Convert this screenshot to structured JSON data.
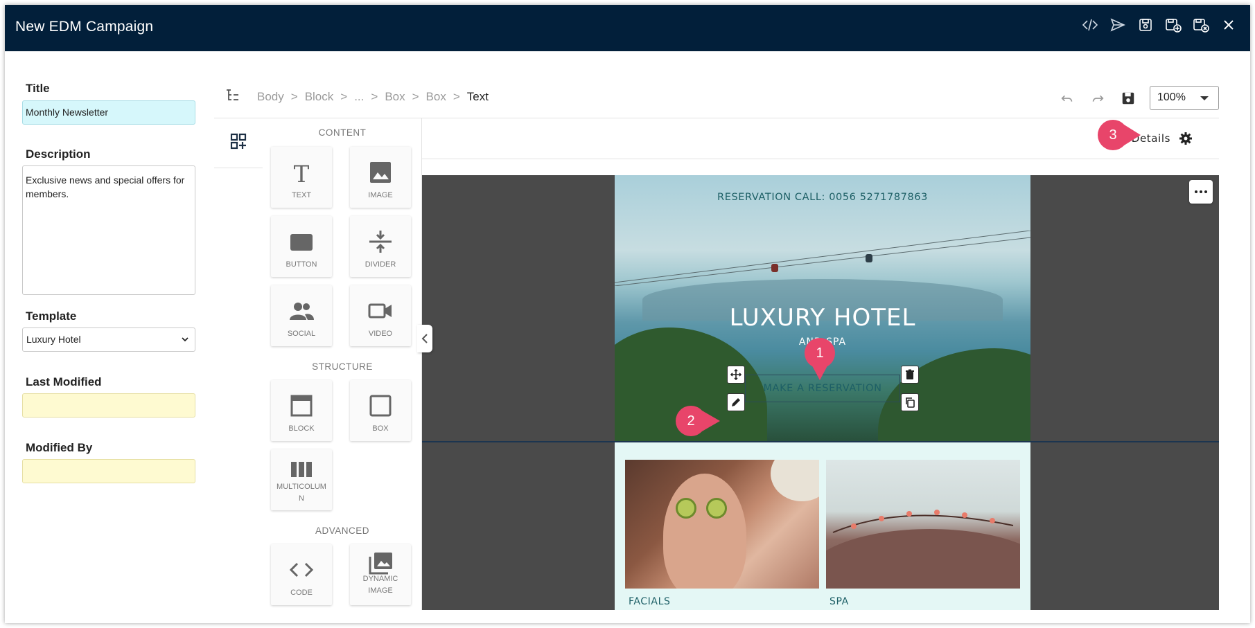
{
  "window": {
    "title": "New EDM Campaign",
    "actions": [
      "code-icon",
      "send-icon",
      "save-icon",
      "save-as-icon",
      "save-close-icon",
      "close-icon"
    ]
  },
  "form": {
    "title_label": "Title",
    "title_value": "Monthly Newsletter",
    "description_label": "Description",
    "description_value": "Exclusive news and special offers for members.",
    "template_label": "Template",
    "template_value": "Luxury Hotel",
    "last_modified_label": "Last Modified",
    "last_modified_value": "",
    "modified_by_label": "Modified By",
    "modified_by_value": ""
  },
  "breadcrumb": {
    "items": [
      "Body",
      "Block",
      "...",
      "Box",
      "Box"
    ],
    "current": "Text",
    "separator": ">"
  },
  "toolbar": {
    "zoom": "100%"
  },
  "blocks": {
    "content_title": "CONTENT",
    "structure_title": "STRUCTURE",
    "advanced_title": "ADVANCED",
    "content": [
      {
        "label": "TEXT",
        "icon": "text-icon"
      },
      {
        "label": "IMAGE",
        "icon": "image-icon"
      },
      {
        "label": "BUTTON",
        "icon": "button-icon"
      },
      {
        "label": "DIVIDER",
        "icon": "divider-icon"
      },
      {
        "label": "SOCIAL",
        "icon": "social-icon"
      },
      {
        "label": "VIDEO",
        "icon": "video-icon"
      }
    ],
    "structure": [
      {
        "label": "BLOCK",
        "icon": "block-icon"
      },
      {
        "label": "BOX",
        "icon": "box-icon"
      },
      {
        "label": "MULTICOLUMN",
        "icon": "multicolumn-icon"
      }
    ],
    "advanced": [
      {
        "label": "CODE",
        "icon": "code-icon"
      },
      {
        "label": "DYNAMIC IMAGE",
        "icon": "dynamic-image-icon"
      }
    ]
  },
  "details": {
    "label": "Details"
  },
  "email": {
    "reservation_call": "RESERVATION CALL: 0056 5271787863",
    "brand": "LUXURY HOTEL",
    "subtitle": "AND SPA",
    "button_text": "MAKE A RESERVATION",
    "caption_left": "FACIALS",
    "caption_right": "SPA"
  },
  "callouts": [
    "1",
    "2",
    "3"
  ],
  "colors": {
    "titlebar": "#021f3a",
    "callout": "#e8456a",
    "title_field": "#d6f7fb",
    "readonly_field": "#fefad1"
  }
}
